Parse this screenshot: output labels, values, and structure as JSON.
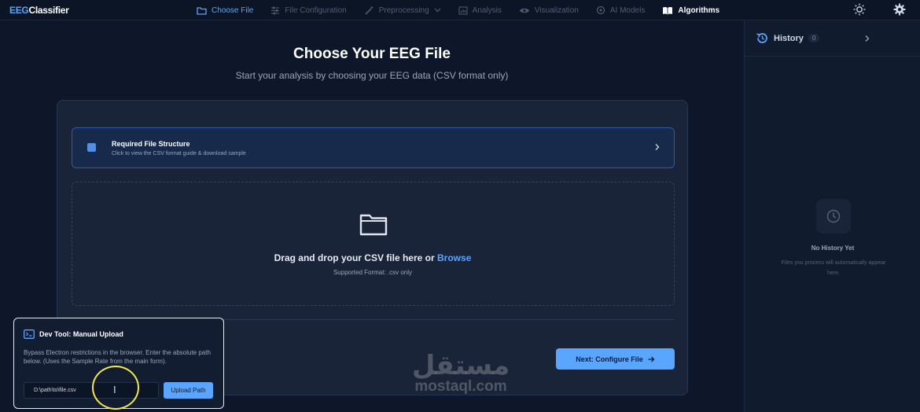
{
  "app": {
    "brand_prefix": "EEG",
    "brand_suffix": "Classifier"
  },
  "nav": [
    {
      "label": "Choose File",
      "icon": "folder-icon",
      "state": "active"
    },
    {
      "label": "File Configuration",
      "icon": "sliders-icon",
      "state": "disabled"
    },
    {
      "label": "Preprocessing",
      "icon": "magic-wand-icon",
      "state": "disabled"
    },
    {
      "label": "Analysis",
      "icon": "chart-icon",
      "state": "disabled"
    },
    {
      "label": "Visualization",
      "icon": "eye-icon",
      "state": "disabled"
    },
    {
      "label": "AI Models",
      "icon": "brain-icon",
      "state": "disabled"
    },
    {
      "label": "Algorithms",
      "icon": "book-icon",
      "state": "enabled"
    }
  ],
  "colors": {
    "accent": "#5aa5ff",
    "background": "#0e1729",
    "card": "#1a2438",
    "highlight": "#f2e84a"
  },
  "page": {
    "title": "Choose Your EEG File",
    "subtitle": "Start your analysis by choosing your EEG data (CSV format only)"
  },
  "required": {
    "title": "Required File Structure",
    "subtitle": "Click to view the CSV format guide & download sample"
  },
  "dropzone": {
    "text": "Drag and drop your CSV file here or",
    "browse": "Browse",
    "format": "Supported Format: .csv only"
  },
  "next_button": "Next: Configure File",
  "history": {
    "title": "History",
    "count": "0",
    "empty_title": "No History Yet",
    "empty_text": "Files you process will automatically appear here."
  },
  "devtool": {
    "title": "Dev Tool: Manual Upload",
    "description": "Bypass Electron restrictions in the browser. Enter the absolute path below. (Uses the Sample Rate from the main form).",
    "input_value": "D:\\path\\to\\file.csv",
    "button": "Upload Path"
  },
  "watermark": {
    "arabic": "مستقل",
    "latin": "mostaql.com"
  }
}
